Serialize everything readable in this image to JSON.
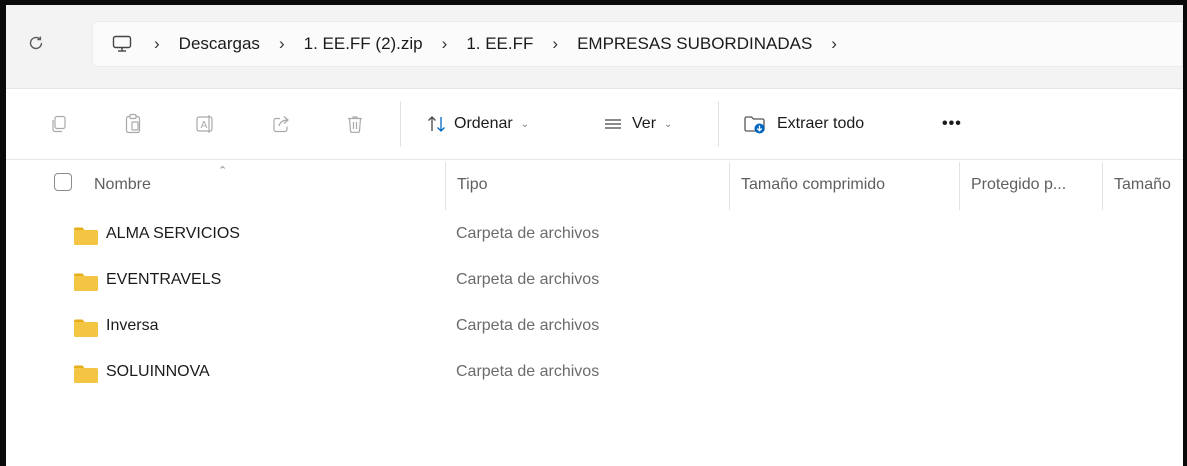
{
  "address_bar": {
    "refresh_icon": "refresh-icon",
    "root_icon": "this-pc-icon",
    "breadcrumb": [
      "Descargas",
      "1. EE.FF (2).zip",
      "1. EE.FF",
      "EMPRESAS SUBORDINADAS"
    ],
    "separator": "›"
  },
  "toolbar": {
    "icons": [
      "copy-icon",
      "paste-icon",
      "rename-icon",
      "share-icon",
      "delete-icon"
    ],
    "sort_label": "Ordenar",
    "view_label": "Ver",
    "extract_label": "Extraer todo",
    "more_label": "•••"
  },
  "columns": {
    "name": "Nombre",
    "type": "Tipo",
    "compressed_size": "Tamaño comprimido",
    "protected": "Protegido p...",
    "size": "Tamaño"
  },
  "rows": [
    {
      "name": "ALMA SERVICIOS",
      "type": "Carpeta de archivos"
    },
    {
      "name": "EVENTRAVELS",
      "type": "Carpeta de archivos"
    },
    {
      "name": "Inversa",
      "type": "Carpeta de archivos"
    },
    {
      "name": "SOLUINNOVA",
      "type": "Carpeta de archivos"
    }
  ],
  "colors": {
    "folder": "#f4c542",
    "folder_tab": "#e6ad1c",
    "accent": "#0067c0",
    "disabled_icon": "#a9a9a9"
  }
}
